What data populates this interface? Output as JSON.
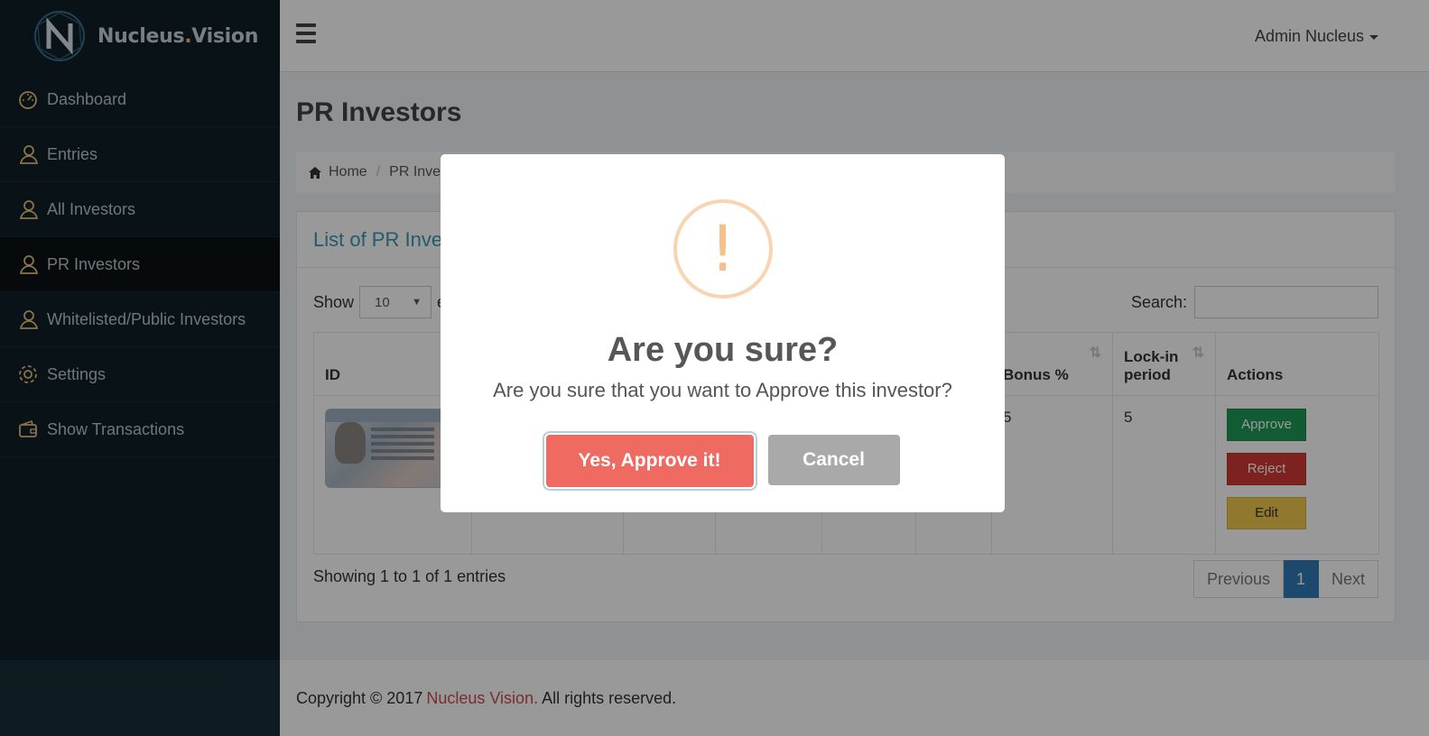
{
  "brand": {
    "name_main": "Nucleus",
    "name_dot": ".",
    "name_tail": "Vision"
  },
  "sidebar": {
    "items": [
      {
        "label": "Dashboard",
        "icon": "dashboard-icon"
      },
      {
        "label": "Entries",
        "icon": "users-icon"
      },
      {
        "label": "All Investors",
        "icon": "users-icon"
      },
      {
        "label": "PR Investors",
        "icon": "users-icon",
        "active": true
      },
      {
        "label": "Whitelisted/Public Investors",
        "icon": "users-icon"
      },
      {
        "label": "Settings",
        "icon": "gear-icon"
      },
      {
        "label": "Show Transactions",
        "icon": "wallet-icon"
      }
    ]
  },
  "header": {
    "user": "Admin Nucleus"
  },
  "page": {
    "title": "PR Investors",
    "breadcrumb": {
      "home": "Home",
      "current": "PR Investors"
    }
  },
  "panel": {
    "title": "List of PR Investors",
    "show_label": "Show",
    "page_size": "10",
    "entries_label": "entries",
    "search_label": "Search:",
    "table": {
      "headers": [
        "ID",
        "",
        "",
        "",
        "",
        "",
        "Bonus %",
        "Lock-in period",
        "Actions"
      ],
      "rows": [
        {
          "bonus": "5",
          "lockin": "5"
        }
      ],
      "actions": {
        "approve": "Approve",
        "reject": "Reject",
        "edit": "Edit"
      }
    },
    "info": "Showing 1 to 1 of 1 entries",
    "pager": {
      "previous": "Previous",
      "current": "1",
      "next": "Next"
    }
  },
  "footer": {
    "prefix": "Copyright © 2017",
    "link": "Nucleus Vision.",
    "suffix": "All rights reserved."
  },
  "modal": {
    "icon": "!",
    "title": "Are you sure?",
    "text": "Are you sure that you want to Approve this investor?",
    "confirm": "Yes, Approve it!",
    "cancel": "Cancel"
  },
  "colors": {
    "sidebar_bg": "#0f1e26",
    "accent_icon": "#e8c078",
    "panel_title": "#3a98b5",
    "approve": "#1f9a56",
    "reject": "#d13a32",
    "edit": "#f0c94e",
    "confirm": "#ef6b61",
    "cancel": "#a9a9a9",
    "pager_active": "#337ab7",
    "footer_link": "#c84b50"
  }
}
